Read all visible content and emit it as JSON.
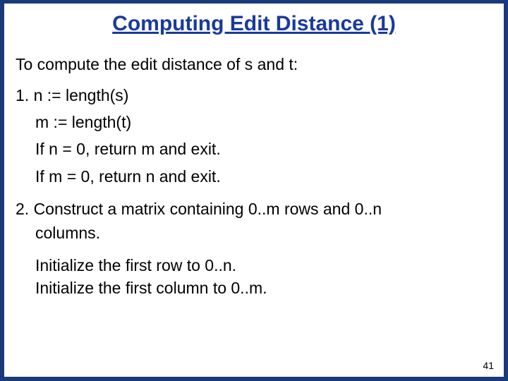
{
  "slide": {
    "title": "Computing Edit Distance (1)",
    "intro": "To compute the edit distance of s and t:",
    "step1": {
      "a": "1. n := length(s)",
      "b": "m := length(t)",
      "c": "If n = 0, return m and exit.",
      "d": "If m = 0, return n and exit."
    },
    "step2": {
      "a": "2. Construct a matrix containing 0..m rows and 0..n",
      "a2": "columns.",
      "b": "Initialize the first row to 0..n.",
      "c": "Initialize the first column to 0..m."
    },
    "page_number": "41"
  }
}
